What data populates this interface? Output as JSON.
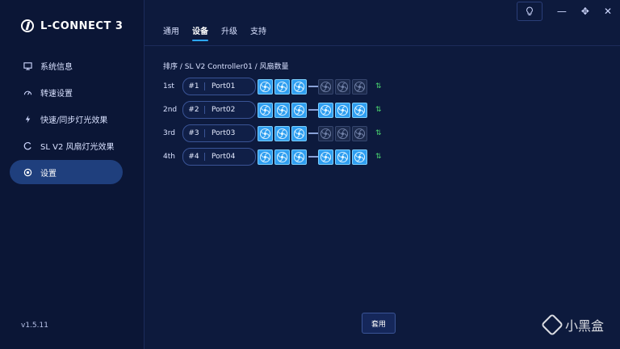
{
  "brand": {
    "title": "L-CONNECT 3"
  },
  "sidebar": {
    "items": [
      {
        "label": "系统信息",
        "icon": "monitor-icon"
      },
      {
        "label": "转速设置",
        "icon": "gauge-icon"
      },
      {
        "label": "快速/同步灯光效果",
        "icon": "lightning-icon"
      },
      {
        "label": "SL V2 风扇灯光效果",
        "icon": "ring-icon"
      },
      {
        "label": "设置",
        "icon": "gear-icon",
        "active": true
      }
    ],
    "version": "v1.5.11"
  },
  "tabs": [
    {
      "label": "通用"
    },
    {
      "label": "设备",
      "active": true
    },
    {
      "label": "升级"
    },
    {
      "label": "支持"
    }
  ],
  "breadcrumb": "排序 / SL V2 Controller01 / 风扇数量",
  "ports": [
    {
      "order": "1st",
      "num": "#1",
      "name": "Port01",
      "group1_on": 3,
      "group2_on": 0
    },
    {
      "order": "2nd",
      "num": "#2",
      "name": "Port02",
      "group1_on": 3,
      "group2_on": 3
    },
    {
      "order": "3rd",
      "num": "#3",
      "name": "Port03",
      "group1_on": 3,
      "group2_on": 0
    },
    {
      "order": "4th",
      "num": "#4",
      "name": "Port04",
      "group1_on": 3,
      "group2_on": 3
    }
  ],
  "apply_label": "套用",
  "watermark": "小黑盒",
  "colors": {
    "fan_on": "#2f9ef0",
    "fan_off": "#1c2a4c",
    "swap_green": "#49d16f",
    "active_nav": "#1f3f7d"
  }
}
